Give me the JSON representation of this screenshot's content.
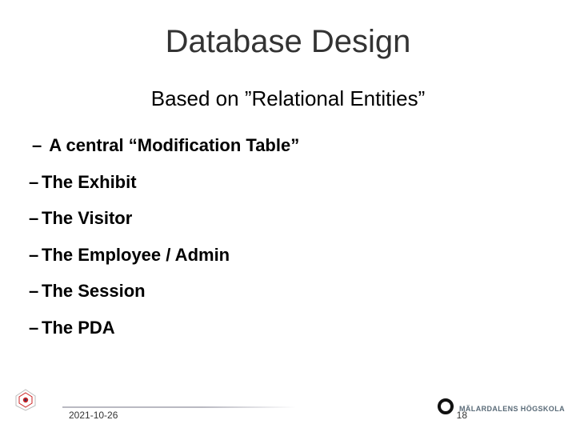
{
  "title": "Database Design",
  "subtitle": "Based on ”Relational Entities”",
  "bullets": [
    " A central “Modification Table”",
    "The Exhibit",
    "The Visitor",
    "The Employee / Admin",
    "The Session",
    "The PDA"
  ],
  "footer": {
    "date": "2021-10-26",
    "page": "18",
    "right_logo_text": "MÄLARDALENS HÖGSKOLA"
  }
}
